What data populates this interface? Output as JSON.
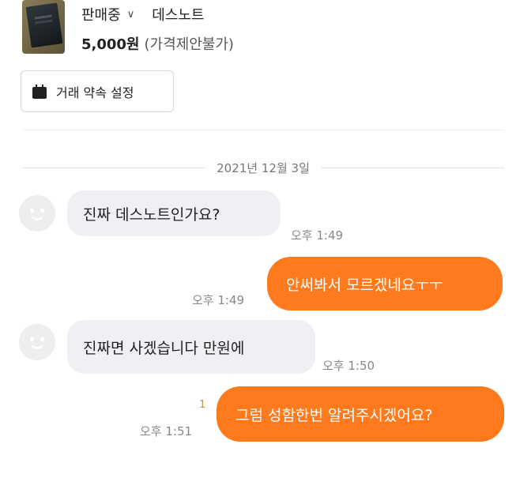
{
  "product": {
    "status": "판매중",
    "title": "데스노트",
    "price": "5,000원",
    "price_note": "(가격제안불가)"
  },
  "schedule_button": {
    "label": "거래 약속 설정"
  },
  "chat": {
    "date": "2021년 12월 3일",
    "messages": [
      {
        "from": "other",
        "text": "진짜 데스노트인가요?",
        "time": "오후 1:49"
      },
      {
        "from": "me",
        "text": "안써봐서 모르겠네요ㅜㅜ",
        "time": "오후 1:49"
      },
      {
        "from": "other",
        "text": "진짜면 사겠습니다 만원에",
        "time": "오후 1:50"
      },
      {
        "from": "me",
        "text": "그럼 성함한번 알려주시겠어요?",
        "time": "오후 1:51",
        "unread": "1"
      }
    ]
  },
  "colors": {
    "outgoing_bubble": "#ff7a1c",
    "incoming_bubble": "#eef0f3",
    "unread_count": "#b2973a"
  }
}
